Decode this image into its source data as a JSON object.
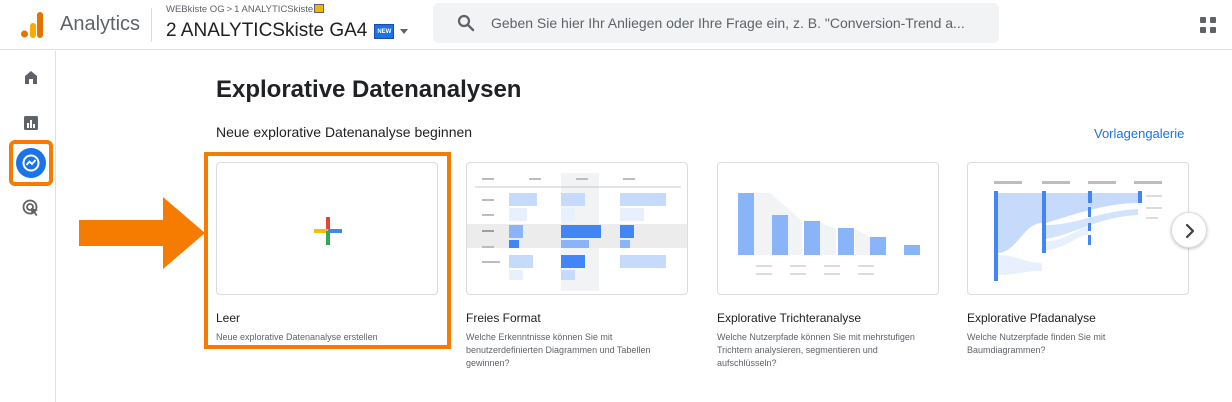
{
  "header": {
    "app_name": "Analytics",
    "breadcrumb": {
      "account": "WEBkiste OG",
      "separator": ">",
      "property_path": "1 ANALYTICSkiste"
    },
    "property_name": "2 ANALYTICSkiste GA4",
    "new_badge": "NEW",
    "search_placeholder": "Geben Sie hier Ihr Anliegen oder Ihre Frage ein, z. B. \"Conversion-Trend a..."
  },
  "colors": {
    "accent": "#1a73e8",
    "highlight": "#f57c00",
    "logo_orange": "#f9ab00",
    "logo_dark": "#e37400"
  },
  "rail": {
    "items": [
      {
        "icon": "home-icon"
      },
      {
        "icon": "reports-icon"
      },
      {
        "icon": "explore-icon",
        "active": true
      },
      {
        "icon": "advertising-icon"
      }
    ]
  },
  "main": {
    "title": "Explorative Datenanalysen",
    "subheading": "Neue explorative Datenanalyse beginnen",
    "gallery_link": "Vorlagengalerie",
    "cards": [
      {
        "title": "Leer",
        "description": "Neue explorative Datenanalyse erstellen"
      },
      {
        "title": "Freies Format",
        "description": "Welche Erkenntnisse können Sie mit benutzerdefinierten Diagrammen und Tabellen gewinnen?"
      },
      {
        "title": "Explorative Trichteranalyse",
        "description": "Welche Nutzerpfade können Sie mit mehrstufigen Trichtern analysieren, segmentieren und aufschlüsseln?"
      },
      {
        "title": "Explorative Pfadanalyse",
        "description": "Welche Nutzerpfade finden Sie mit Baumdiagrammen?"
      }
    ]
  }
}
